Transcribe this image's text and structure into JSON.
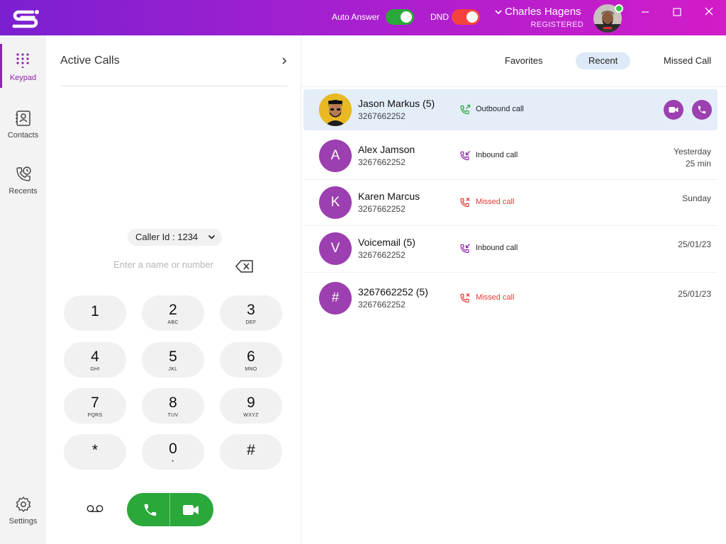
{
  "titlebar": {
    "auto_answer_label": "Auto Answer",
    "auto_answer_on": true,
    "dnd_label": "DND",
    "dnd_on": true,
    "user_name": "Charles Hagens",
    "user_status": "REGISTERED",
    "online": true,
    "colors": {
      "gradient_start": "#7b1fd0",
      "gradient_end": "#d21cc8",
      "toggle_green": "#2aa83a",
      "toggle_red": "#f4433f"
    }
  },
  "nav": {
    "items": [
      {
        "label": "Keypad",
        "icon": "keypad-icon",
        "active": true
      },
      {
        "label": "Contacts",
        "icon": "contacts-icon",
        "active": false
      },
      {
        "label": "Recents",
        "icon": "recents-icon",
        "active": false
      }
    ],
    "settings_label": "Settings",
    "accent": "#8e24aa"
  },
  "keypad": {
    "active_calls_label": "Active Calls",
    "caller_id": "Caller Id : 1234",
    "input_placeholder": "Enter a name or number",
    "input_value": "",
    "keys": [
      {
        "digit": "1",
        "letters": ""
      },
      {
        "digit": "2",
        "letters": "ABC"
      },
      {
        "digit": "3",
        "letters": "DEF"
      },
      {
        "digit": "4",
        "letters": "GHI"
      },
      {
        "digit": "5",
        "letters": "JKL"
      },
      {
        "digit": "6",
        "letters": "MNO"
      },
      {
        "digit": "7",
        "letters": "PQRS"
      },
      {
        "digit": "8",
        "letters": "TUV"
      },
      {
        "digit": "9",
        "letters": "WXYZ"
      },
      {
        "digit": "*",
        "letters": ""
      },
      {
        "digit": "0",
        "letters": "+"
      },
      {
        "digit": "#",
        "letters": ""
      }
    ],
    "call_button_color": "#2aa83a"
  },
  "tabs": [
    {
      "label": "Favorites",
      "active": false
    },
    {
      "label": "Recent",
      "active": true
    },
    {
      "label": "Missed Call",
      "active": false
    }
  ],
  "recents": [
    {
      "name": "Jason Markus (5)",
      "number": "3267662252",
      "type": "Outbound call",
      "kind": "outbound",
      "avatar": "photo",
      "when1": "",
      "when2": "",
      "selected": true
    },
    {
      "name": "Alex Jamson",
      "number": "3267662252",
      "type": "Inbound call",
      "kind": "inbound",
      "avatar": "A",
      "when1": "Yesterday",
      "when2": "25 min",
      "selected": false
    },
    {
      "name": "Karen Marcus",
      "number": "3267662252",
      "type": "Missed call",
      "kind": "missed",
      "avatar": "K",
      "when1": "Sunday",
      "when2": "",
      "selected": false
    },
    {
      "name": "Voicemail (5)",
      "number": "3267662252",
      "type": "Inbound call",
      "kind": "inbound",
      "avatar": "V",
      "when1": "25/01/23",
      "when2": "",
      "selected": false
    },
    {
      "name": "3267662252 (5)",
      "number": "3267662252",
      "type": "Missed call",
      "kind": "missed",
      "avatar": "#",
      "when1": "25/01/23",
      "when2": "",
      "selected": false
    }
  ],
  "colors": {
    "purple": "#9c3fb0",
    "missed_red": "#e53935",
    "outbound_green": "#2aa83a",
    "inbound_purple": "#8e24aa",
    "selected_row": "#e3eef9"
  }
}
